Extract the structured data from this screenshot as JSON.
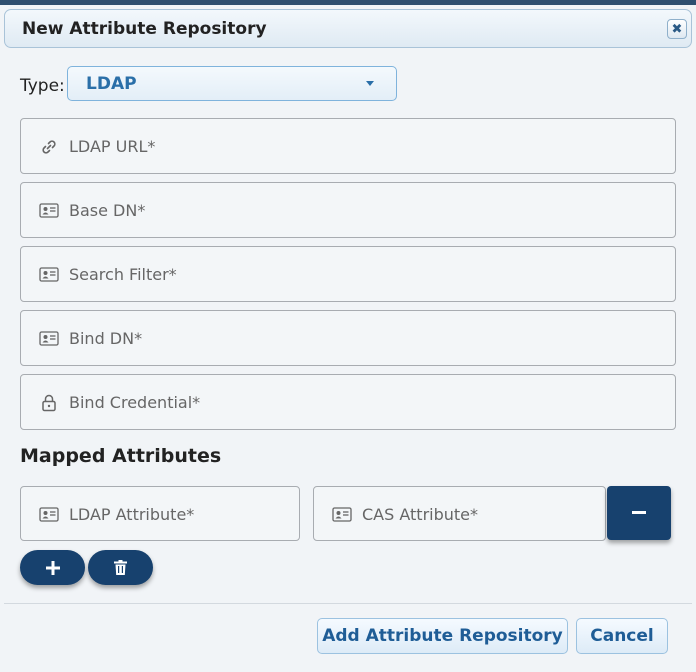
{
  "dialog": {
    "title": "New Attribute Repository",
    "close_icon": "close-icon"
  },
  "type": {
    "label": "Type:",
    "value": "LDAP"
  },
  "fields": {
    "ldap_url": "LDAP URL*",
    "base_dn": "Base DN*",
    "search_filter": "Search Filter*",
    "bind_dn": "Bind DN*",
    "bind_credential": "Bind Credential*"
  },
  "mapped": {
    "title": "Mapped Attributes",
    "ldap_attribute": "LDAP Attribute*",
    "cas_attribute": "CAS Attribute*"
  },
  "footer": {
    "add_label": "Add Attribute Repository",
    "cancel_label": "Cancel"
  },
  "colors": {
    "accent": "#17416e",
    "link": "#1f5d96"
  }
}
